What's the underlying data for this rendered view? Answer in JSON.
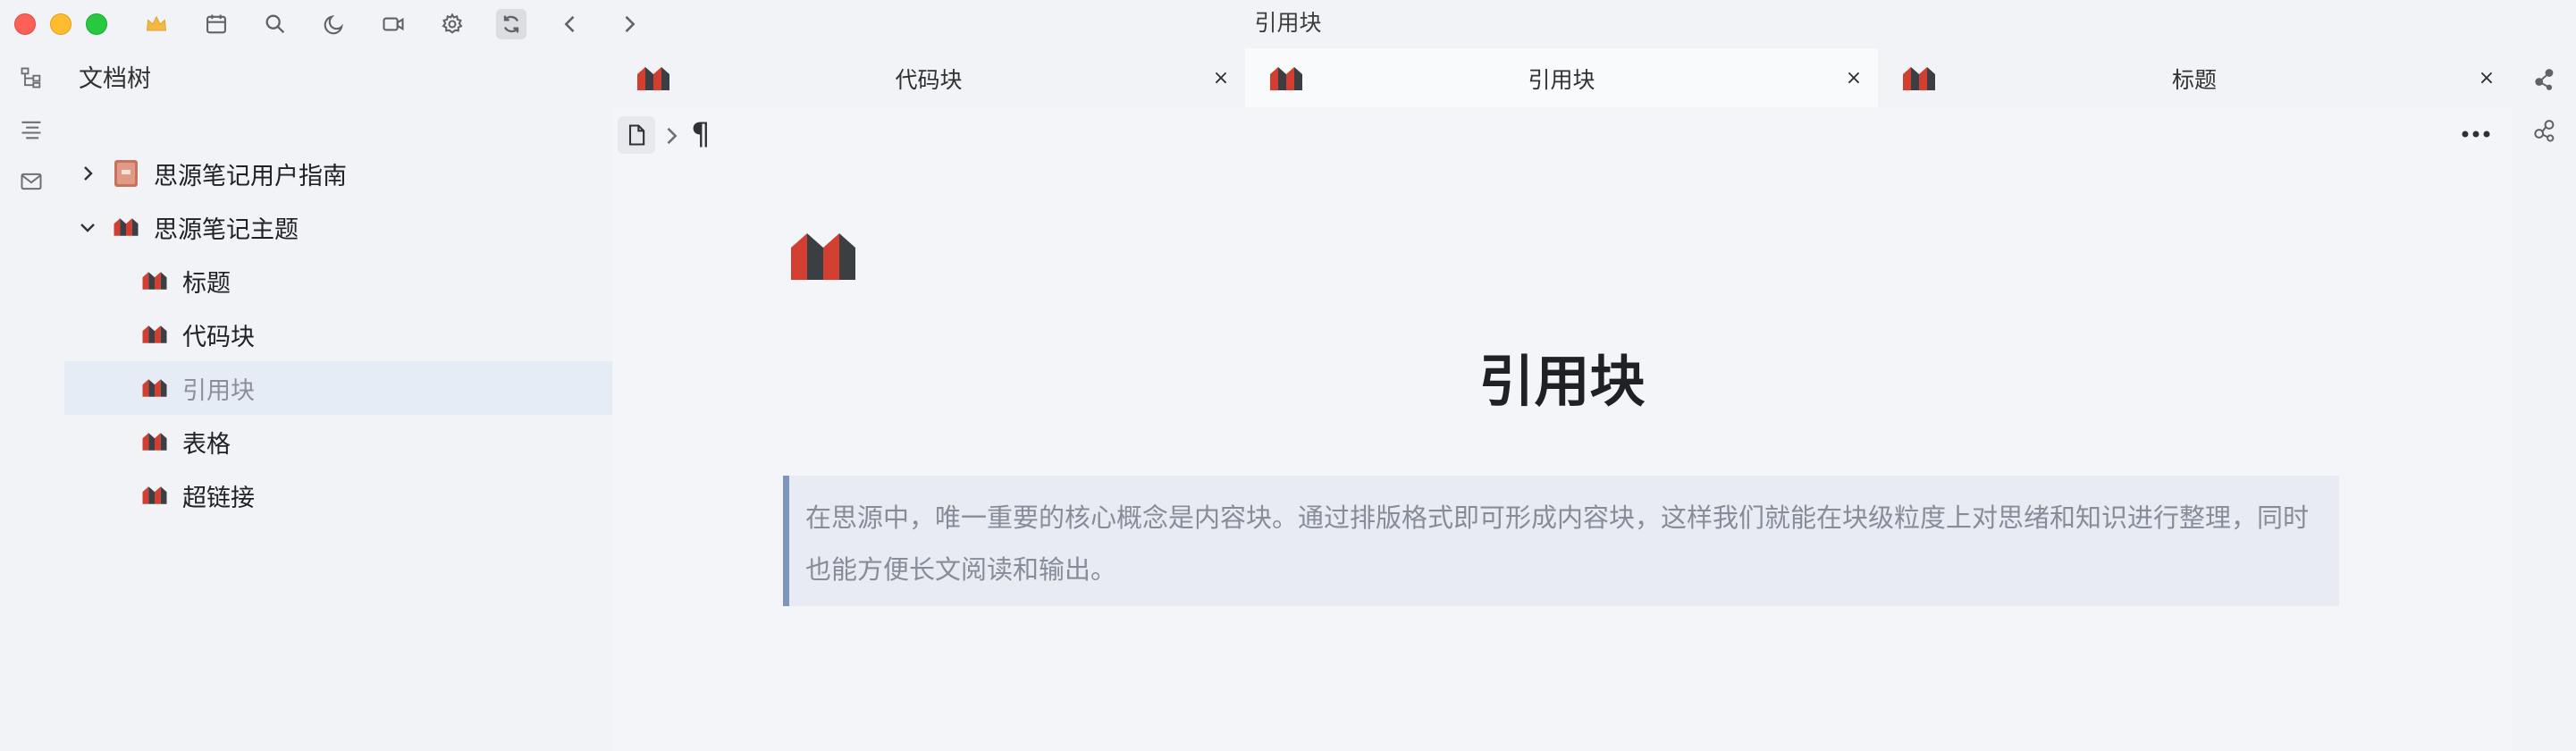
{
  "window": {
    "title": "引用块"
  },
  "filetree": {
    "title": "文档树",
    "items": [
      {
        "label": "思源笔记用户指南",
        "level": 0,
        "expanded": false,
        "icon": "book-icon"
      },
      {
        "label": "思源笔记主题",
        "level": 0,
        "expanded": true,
        "icon": "siyuan-logo-icon"
      },
      {
        "label": "标题",
        "level": 1,
        "icon": "siyuan-logo-icon"
      },
      {
        "label": "代码块",
        "level": 1,
        "icon": "siyuan-logo-icon"
      },
      {
        "label": "引用块",
        "level": 1,
        "icon": "siyuan-logo-icon",
        "active": true
      },
      {
        "label": "表格",
        "level": 1,
        "icon": "siyuan-logo-icon"
      },
      {
        "label": "超链接",
        "level": 1,
        "icon": "siyuan-logo-icon"
      }
    ]
  },
  "tabs": [
    {
      "label": "代码块",
      "active": false
    },
    {
      "label": "引用块",
      "active": true
    },
    {
      "label": "标题",
      "active": false
    }
  ],
  "tab_close_glyph": "×",
  "editor": {
    "breadcrumb_para": "¶",
    "title": "引用块",
    "blockquote_text": "在思源中，唯一重要的核心概念是内容块。通过排版格式即可形成内容块，这样我们就能在块级粒度上对思绪和知识进行整理，同时也能方便长文阅读和输出。"
  },
  "colors": {
    "accent_blockquote": "#7f96bc",
    "logo_red": "#d23f31",
    "logo_dark": "#3b3e43",
    "active_row": "#e6ecf5"
  }
}
